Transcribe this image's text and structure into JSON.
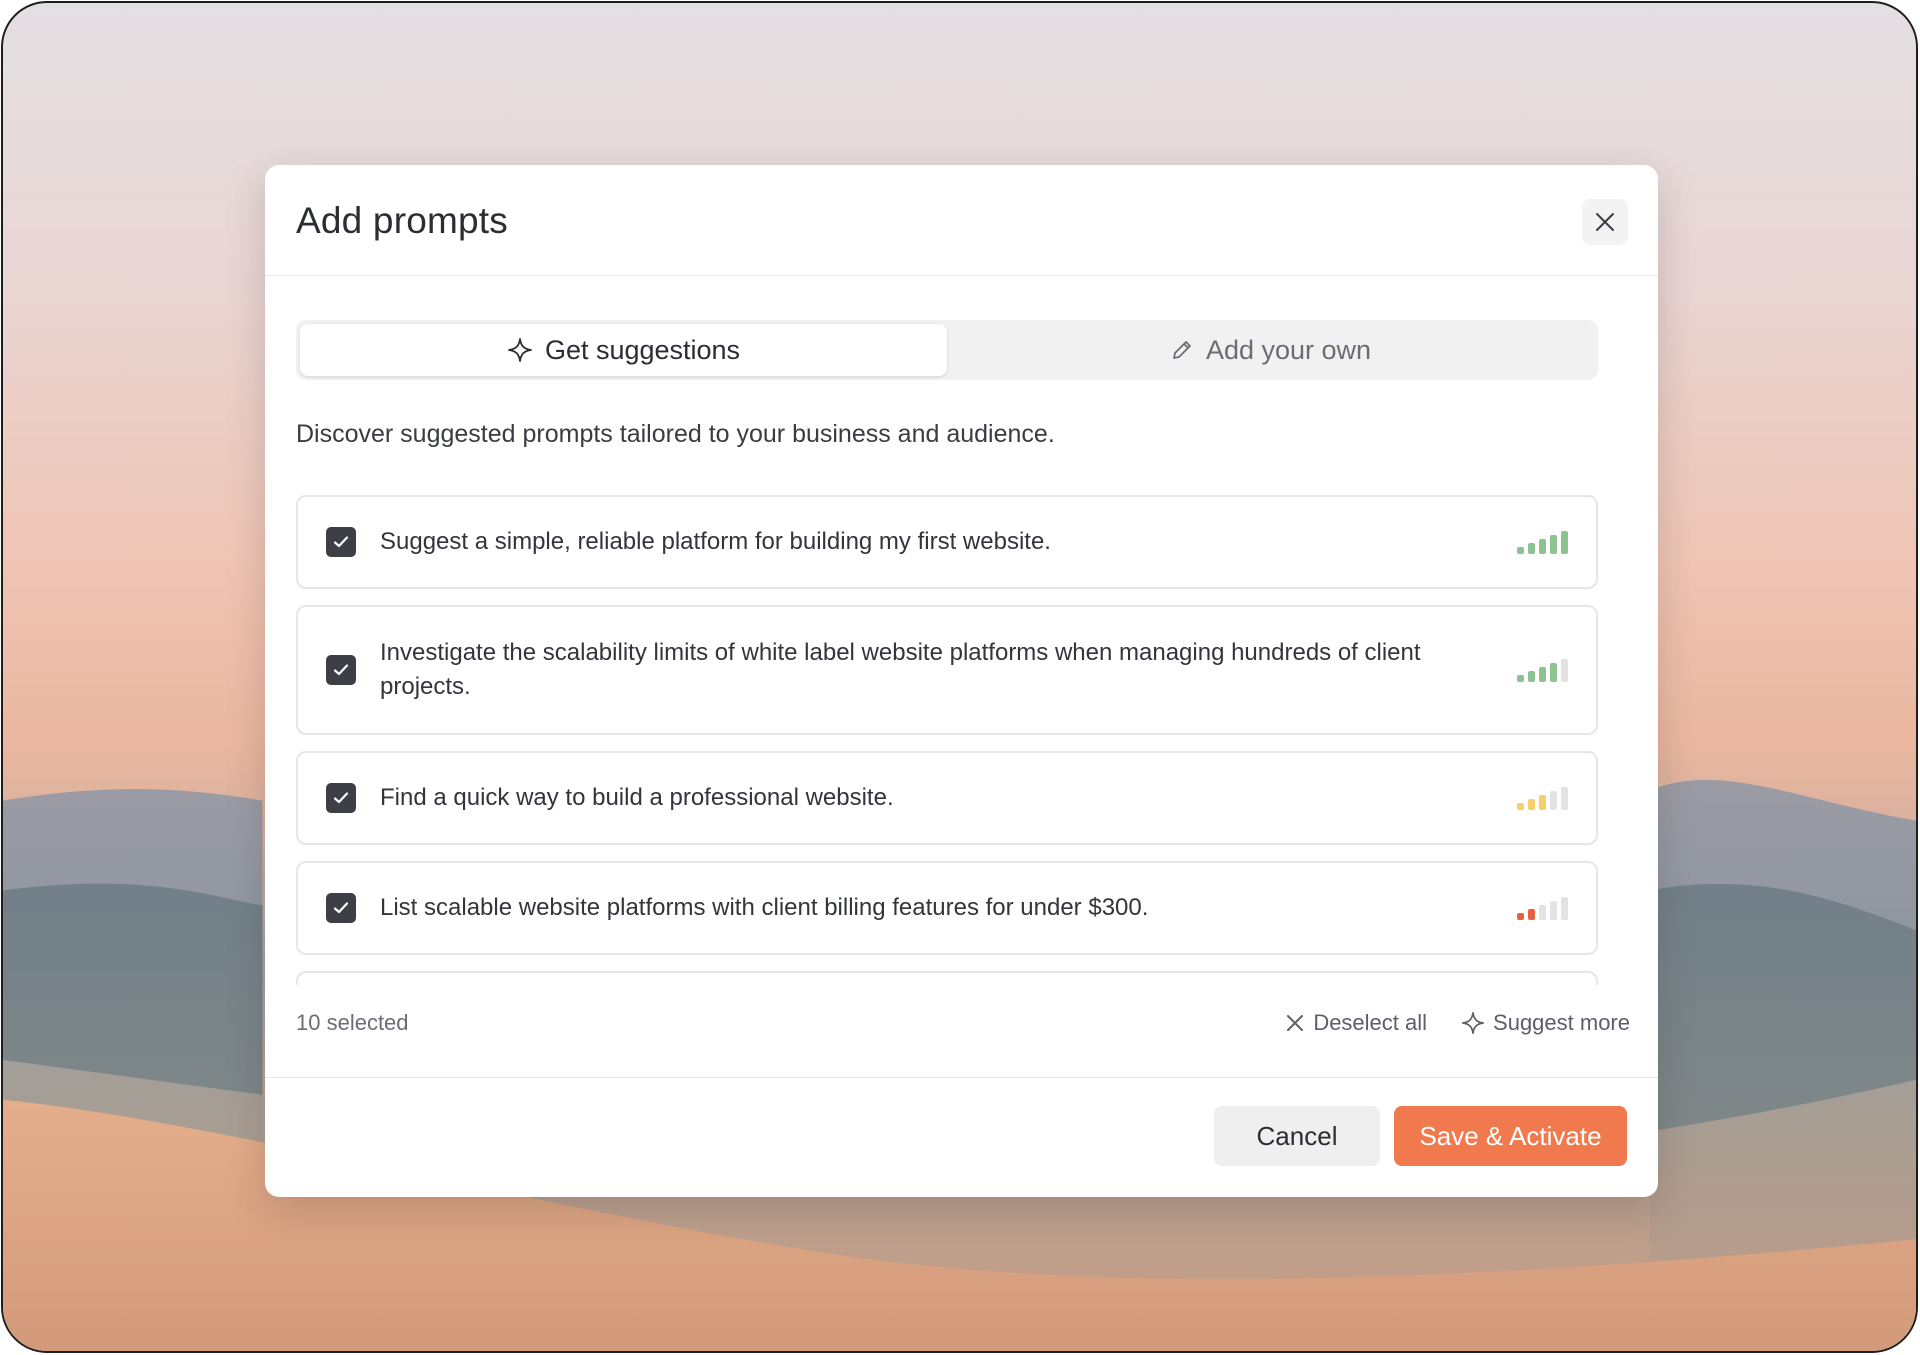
{
  "dialog": {
    "title": "Add prompts",
    "close_icon": "close-icon"
  },
  "tabs": [
    {
      "label": "Get suggestions",
      "icon": "sparkle-icon",
      "active": true
    },
    {
      "label": "Add your own",
      "icon": "pencil-icon",
      "active": false
    }
  ],
  "description": "Discover suggested prompts tailored to your business and audience.",
  "prompts": [
    {
      "text": "Suggest a simple, reliable platform for building my first website.",
      "checked": true,
      "strength": 5,
      "strength_color": "#8cc391"
    },
    {
      "text": "Investigate the scalability limits of white label website platforms when managing hundreds of client projects.",
      "checked": true,
      "strength": 4,
      "strength_color": "#8cc391"
    },
    {
      "text": "Find a quick way to build a professional website.",
      "checked": true,
      "strength": 3,
      "strength_color": "#f5cf6b"
    },
    {
      "text": "List scalable website platforms with client billing features for under $300.",
      "checked": true,
      "strength": 2,
      "strength_color": "#e9603e"
    },
    {
      "text": "",
      "checked": true,
      "strength": 0,
      "strength_color": "#e3e3e5"
    }
  ],
  "footer": {
    "selected_count": "10 selected",
    "deselect_all": "Deselect all",
    "suggest_more": "Suggest more"
  },
  "actions": {
    "cancel": "Cancel",
    "save": "Save & Activate"
  },
  "colors": {
    "accent": "#f07a4e",
    "checkbox": "#3d3f46",
    "signal_inactive": "#e3e3e5"
  }
}
